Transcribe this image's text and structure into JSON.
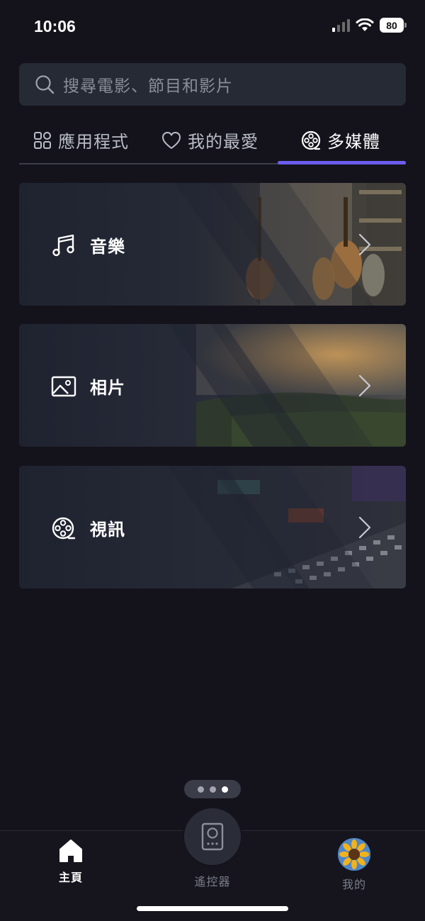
{
  "status_bar": {
    "time": "10:06",
    "battery": "80"
  },
  "search": {
    "placeholder": "搜尋電影、節目和影片"
  },
  "tabs": [
    {
      "label": "應用程式",
      "icon": "apps-grid-icon",
      "active": false
    },
    {
      "label": "我的最愛",
      "icon": "heart-icon",
      "active": false
    },
    {
      "label": "多媒體",
      "icon": "film-reel-icon",
      "active": true
    }
  ],
  "media_cards": [
    {
      "label": "音樂",
      "icon": "music-note-icon"
    },
    {
      "label": "相片",
      "icon": "image-icon"
    },
    {
      "label": "視訊",
      "icon": "film-reel-icon"
    }
  ],
  "pager": {
    "total": 3,
    "active_index": 2
  },
  "bottom_nav": [
    {
      "label": "主頁",
      "icon": "home-icon",
      "active": true
    },
    {
      "label": "遙控器",
      "icon": "remote-icon",
      "active": false
    },
    {
      "label": "我的",
      "icon": "avatar-sunflower",
      "active": false
    }
  ],
  "colors": {
    "background": "#14131c",
    "accent": "#6d5cf0",
    "card": "#242835"
  }
}
